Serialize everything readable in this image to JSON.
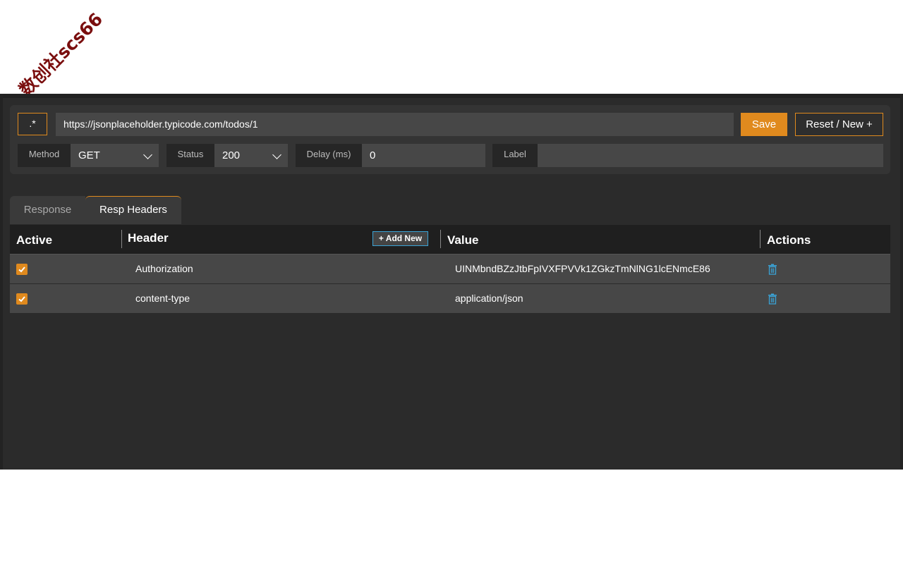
{
  "watermark": "数创社scs66",
  "toolbar": {
    "regex_label": ".*",
    "url": "https://jsonplaceholder.typicode.com/todos/1",
    "save_label": "Save",
    "reset_label": "Reset / New +"
  },
  "fields": {
    "method_label": "Method",
    "method_value": "GET",
    "status_label": "Status",
    "status_value": "200",
    "delay_label": "Delay (ms)",
    "delay_value": "0",
    "label_label": "Label",
    "label_value": ""
  },
  "tabs": [
    {
      "label": "Response"
    },
    {
      "label": "Resp Headers"
    }
  ],
  "table": {
    "columns": {
      "active": "Active",
      "header": "Header",
      "value": "Value",
      "actions": "Actions"
    },
    "add_new_label": "+ Add New",
    "rows": [
      {
        "header": "Authorization",
        "value": "UINMbndBZzJtbFpIVXFPVVk1ZGkzTmNlNG1lcENmcE86",
        "active": true
      },
      {
        "header": "content-type",
        "value": "application/json",
        "active": true
      }
    ]
  },
  "colors": {
    "accent": "#e08a1e",
    "link": "#3aa3d6",
    "background": "#2b2b2b"
  }
}
